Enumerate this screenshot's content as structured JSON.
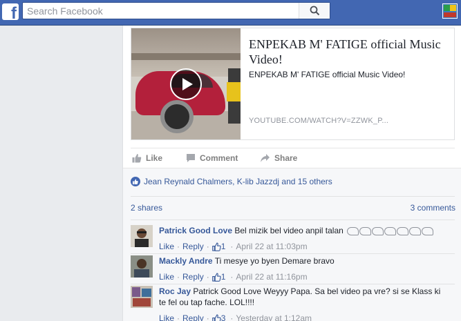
{
  "topbar": {
    "logo_letter": "f",
    "search_placeholder": "Search Facebook"
  },
  "post": {
    "link": {
      "title": "ENPEKAB M' FATIGE official Music Video!",
      "description": "ENPEKAB M' FATIGE official Music Video!",
      "url": "YOUTUBE.COM/WATCH?V=ZZWK_P..."
    },
    "actions": {
      "like": "Like",
      "comment": "Comment",
      "share": "Share"
    },
    "likes_summary": "Jean Reynald Chalmers, K-lib Jazzdj and 15 others",
    "shares": "2 shares",
    "comments_count": "3 comments"
  },
  "comments": [
    {
      "author": "Patrick Good Love",
      "text": "Bel mizik bel video anpil talan",
      "like": "Like",
      "reply": "Reply",
      "like_count": "1",
      "time": "April 22 at 11:03pm"
    },
    {
      "author": "Mackly Andre",
      "text": "Ti mesye yo byen Demare bravo",
      "like": "Like",
      "reply": "Reply",
      "like_count": "1",
      "time": "April 22 at 11:16pm"
    },
    {
      "author": "Roc Jay",
      "text": "Patrick Good Love Weyyy Papa. Sa bel video pa vre? si se Klass ki te fel ou tap fache. LOL!!!!",
      "like": "Like",
      "reply": "Reply",
      "like_count": "3",
      "time": "Yesterday at 1:12am"
    }
  ],
  "colors": {
    "brand": "#4267b2",
    "link": "#365899",
    "muted": "#90949c"
  }
}
